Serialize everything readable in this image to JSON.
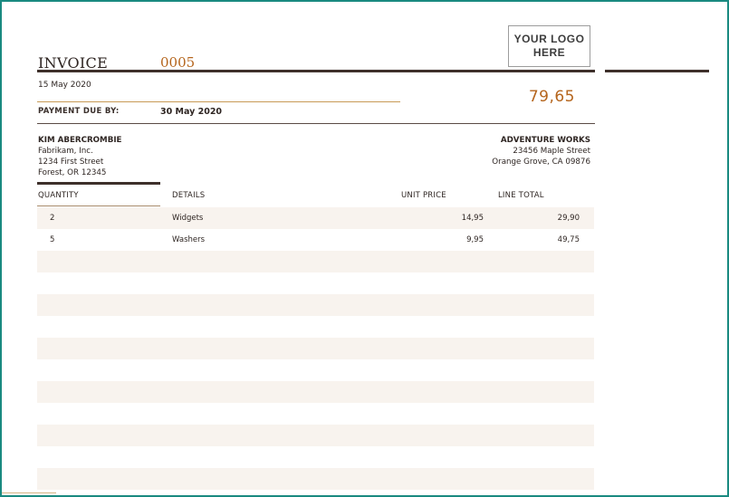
{
  "invoice": {
    "title": "INVOICE",
    "number": "0005",
    "date": "15 May 2020",
    "total": "79,65",
    "payment_due_label": "PAYMENT DUE BY:",
    "payment_due_date": "30 May 2020",
    "logo_text": "YOUR LOGO\nHERE"
  },
  "bill_to": {
    "name": "KIM ABERCROMBIE",
    "company": "Fabrikam, Inc.",
    "street": "1234 First Street",
    "city": "Forest,  OR 12345"
  },
  "from": {
    "name": "ADVENTURE WORKS",
    "street": "23456 Maple Street",
    "city": "Orange Grove, CA 09876"
  },
  "table": {
    "headers": {
      "quantity": "QUANTITY",
      "details": "DETAILS",
      "unit_price": "UNIT PRICE",
      "line_total": "LINE TOTAL"
    },
    "rows": [
      {
        "quantity": "2",
        "details": "Widgets",
        "unit_price": "14,95",
        "line_total": "29,90"
      },
      {
        "quantity": "5",
        "details": "Washers",
        "unit_price": "9,95",
        "line_total": "49,75"
      }
    ]
  },
  "colors": {
    "accent": "#b5651d",
    "frame": "#1a8a80",
    "rule": "#3e302b",
    "row_shade": "#f8f3ee"
  }
}
